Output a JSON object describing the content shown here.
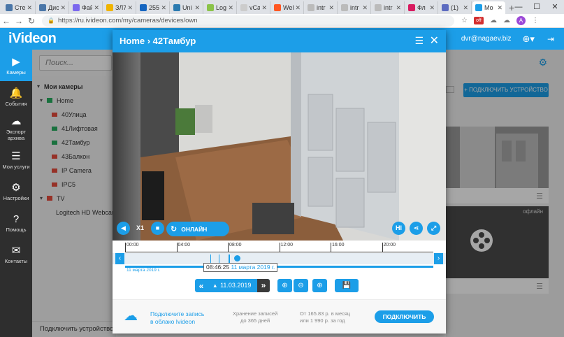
{
  "browser": {
    "tabs": [
      {
        "label": "Сте",
        "color": "#4a76a8"
      },
      {
        "label": "Дис",
        "color": "#4a76a8"
      },
      {
        "label": "Фай",
        "color": "#7b68ee"
      },
      {
        "label": "ЗЛ7",
        "color": "#f0b400"
      },
      {
        "label": "255",
        "color": "#1565c0"
      },
      {
        "label": "Uni",
        "color": "#2a7ab0"
      },
      {
        "label": "Log",
        "color": "#8bc34a"
      },
      {
        "label": "vCa",
        "color": "#cccccc"
      },
      {
        "label": "Wel",
        "color": "#ff5722"
      },
      {
        "label": "intr",
        "color": "#bbbbbb"
      },
      {
        "label": "intr",
        "color": "#bbbbbb"
      },
      {
        "label": "intr",
        "color": "#bbbbbb"
      },
      {
        "label": "Фл",
        "color": "#d81b60"
      },
      {
        "label": "(1)",
        "color": "#5c6bc0"
      },
      {
        "label": "Мо",
        "color": "#1c9ee8"
      }
    ],
    "new_tab": "+",
    "url": "https://ru.ivideon.com/my/cameras/devices/own",
    "badge": "off",
    "avatar_letter": "A"
  },
  "header": {
    "logo": "iVideon",
    "user": "dvr@nagaev.biz"
  },
  "sidebar": {
    "items": [
      {
        "label": "Камеры",
        "icon": "▶"
      },
      {
        "label": "События",
        "icon": "🔔"
      },
      {
        "label": "Экспорт архива",
        "icon": "☁"
      },
      {
        "label": "Мои услуги",
        "icon": "☰"
      },
      {
        "label": "Настройки",
        "icon": "⚙"
      },
      {
        "label": "Помощь",
        "icon": "?"
      },
      {
        "label": "Контакты",
        "icon": "✉"
      }
    ]
  },
  "search": {
    "placeholder": "Поиск..."
  },
  "tree": {
    "root": "Мои камеры",
    "groups": [
      {
        "name": "Home",
        "color": "green",
        "cameras": [
          {
            "name": "40Улица",
            "color": "red"
          },
          {
            "name": "41Лифтовая",
            "color": "green"
          },
          {
            "name": "42Тамбур",
            "color": "green"
          },
          {
            "name": "43Балкон",
            "color": "red"
          },
          {
            "name": "IP Camera",
            "color": "red"
          },
          {
            "name": "IPC5",
            "color": "red"
          }
        ]
      },
      {
        "name": "TV",
        "color": "red",
        "cameras": [
          {
            "name": "Logitech HD Webcam C270",
            "color": "red"
          }
        ]
      }
    ]
  },
  "add_device": "Подключить устройство",
  "right": {
    "connect_btn": "+ ПОДКЛЮЧИТЬ УСТРОЙСТВО",
    "offline": "офлайн"
  },
  "modal": {
    "title": "Home › 42Тамбур",
    "speed": "X1",
    "online": "ОНЛАЙН",
    "hi": "HI",
    "timeline": {
      "ticks": [
        "00:00",
        "04:00",
        "08:00",
        "12:00",
        "16:00",
        "20:00"
      ],
      "date_left": "11 марта 2019 г.",
      "cursor_time": "08:46:25",
      "cursor_date": "11 марта 2019 г."
    },
    "date_value": "11.03.2019",
    "footer": {
      "cloud_line1": "Подключите запись",
      "cloud_line2": "в облако Ivideon",
      "storage_line1": "Хранение записей",
      "storage_line2": "до 365 дней",
      "price_line1": "От 165.83 р. в месяц",
      "price_line2": "или 1 990 р. за год",
      "connect": "ПОДКЛЮЧИТЬ"
    }
  }
}
